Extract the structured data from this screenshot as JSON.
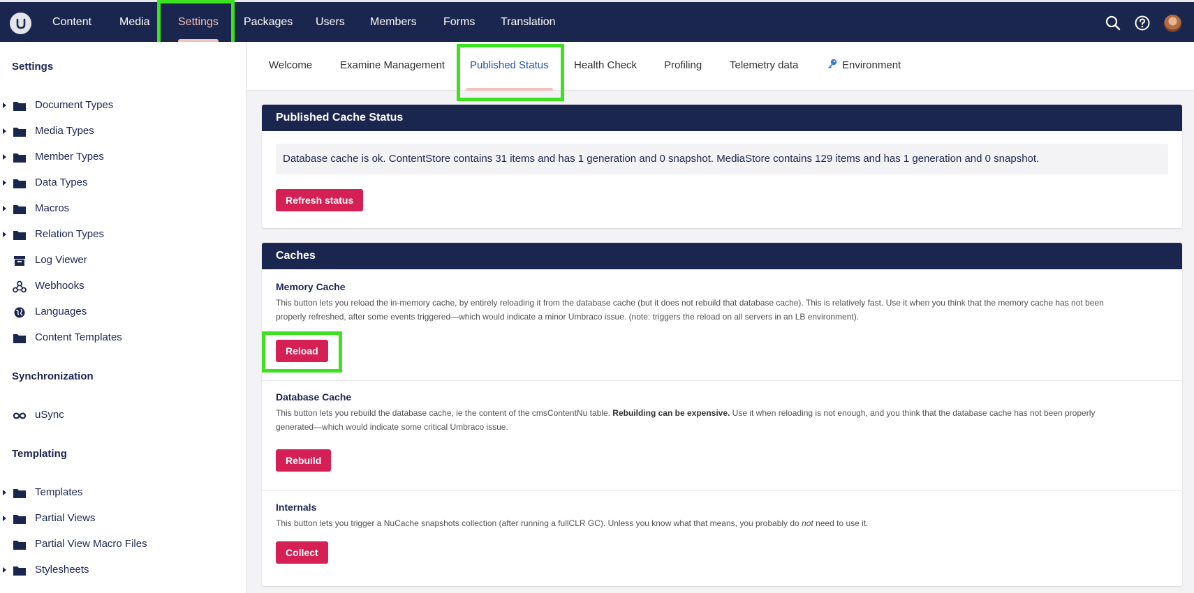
{
  "topnav": {
    "items": [
      {
        "label": "Content",
        "active": false
      },
      {
        "label": "Media",
        "active": false
      },
      {
        "label": "Settings",
        "active": true
      },
      {
        "label": "Packages",
        "active": false
      },
      {
        "label": "Users",
        "active": false
      },
      {
        "label": "Members",
        "active": false
      },
      {
        "label": "Forms",
        "active": false
      },
      {
        "label": "Translation",
        "active": false
      }
    ],
    "icons": [
      "search-icon",
      "help-icon",
      "user-avatar"
    ]
  },
  "sidebar": {
    "sections": [
      {
        "title": "Settings",
        "items": [
          {
            "label": "Document Types",
            "icon": "folder-icon",
            "expandable": true
          },
          {
            "label": "Media Types",
            "icon": "folder-icon",
            "expandable": true
          },
          {
            "label": "Member Types",
            "icon": "folder-icon",
            "expandable": true
          },
          {
            "label": "Data Types",
            "icon": "folder-icon",
            "expandable": true
          },
          {
            "label": "Macros",
            "icon": "folder-icon",
            "expandable": true
          },
          {
            "label": "Relation Types",
            "icon": "folder-icon",
            "expandable": true
          },
          {
            "label": "Log Viewer",
            "icon": "archive-icon",
            "expandable": false
          },
          {
            "label": "Webhooks",
            "icon": "webhook-icon",
            "expandable": false
          },
          {
            "label": "Languages",
            "icon": "globe-icon",
            "expandable": false
          },
          {
            "label": "Content Templates",
            "icon": "folder-icon",
            "expandable": false
          }
        ]
      },
      {
        "title": "Synchronization",
        "items": [
          {
            "label": "uSync",
            "icon": "infinity-icon",
            "expandable": false
          }
        ]
      },
      {
        "title": "Templating",
        "items": [
          {
            "label": "Templates",
            "icon": "folder-icon",
            "expandable": true
          },
          {
            "label": "Partial Views",
            "icon": "folder-icon",
            "expandable": true
          },
          {
            "label": "Partial View Macro Files",
            "icon": "folder-icon",
            "expandable": false
          },
          {
            "label": "Stylesheets",
            "icon": "folder-icon",
            "expandable": true
          }
        ]
      }
    ]
  },
  "tabs": [
    {
      "label": "Welcome",
      "active": false
    },
    {
      "label": "Examine Management",
      "active": false
    },
    {
      "label": "Published Status",
      "active": true
    },
    {
      "label": "Health Check",
      "active": false
    },
    {
      "label": "Profiling",
      "active": false
    },
    {
      "label": "Telemetry data",
      "active": false
    },
    {
      "label": "Environment",
      "active": false,
      "icon": "key-icon"
    }
  ],
  "published_cache": {
    "title": "Published Cache Status",
    "status_text": "Database cache is ok. ContentStore contains 31 items and has 1 generation and 0 snapshot. MediaStore contains 129 items and has 1 generation and 0 snapshot.",
    "refresh_label": "Refresh status"
  },
  "caches": {
    "title": "Caches",
    "memory": {
      "title": "Memory Cache",
      "desc_line1": "This button lets you reload the in-memory cache, by entirely reloading it from the database cache (but it does not rebuild that database cache). This is relatively fast. Use it when you think that the memory cache has not been",
      "desc_line2": "properly refreshed, after some events triggered—which would indicate a minor Umbraco issue. (note: triggers the reload on all servers in an LB environment).",
      "button_label": "Reload"
    },
    "database": {
      "title": "Database Cache",
      "desc_part1": "This button lets you rebuild the database cache, ie the content of the cmsContentNu table. ",
      "desc_bold": "Rebuilding can be expensive.",
      "desc_part2": " Use it when reloading is not enough, and you think that the database cache has not been properly",
      "desc_line2": "generated—which would indicate some critical Umbraco issue.",
      "button_label": "Rebuild"
    },
    "internals": {
      "title": "Internals",
      "desc_part1": "This button lets you trigger a NuCache snapshots collection (after running a fullCLR GC). Unless you know what that means, you probably do ",
      "desc_italic": "not",
      "desc_part2": " need to use it.",
      "button_label": "Collect"
    }
  },
  "colors": {
    "navy": "#1b264f",
    "button": "#d42054",
    "active_tab_underline": "#f5c1bc",
    "highlight": "#3ce11f"
  }
}
